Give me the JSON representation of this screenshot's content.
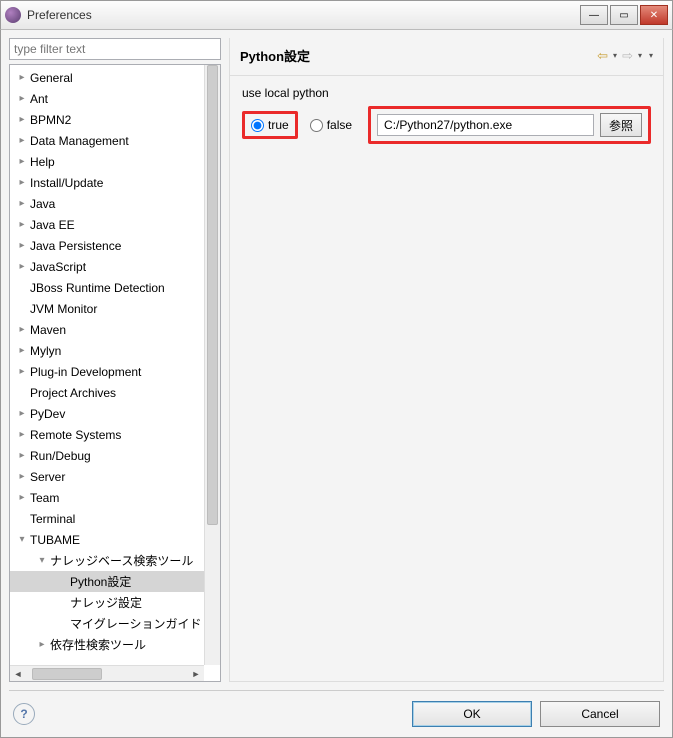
{
  "titlebar": {
    "title": "Preferences"
  },
  "filter": {
    "placeholder": "type filter text"
  },
  "tree": [
    {
      "label": "General",
      "depth": 1,
      "expandable": true,
      "expanded": false
    },
    {
      "label": "Ant",
      "depth": 1,
      "expandable": true,
      "expanded": false
    },
    {
      "label": "BPMN2",
      "depth": 1,
      "expandable": true,
      "expanded": false
    },
    {
      "label": "Data Management",
      "depth": 1,
      "expandable": true,
      "expanded": false
    },
    {
      "label": "Help",
      "depth": 1,
      "expandable": true,
      "expanded": false
    },
    {
      "label": "Install/Update",
      "depth": 1,
      "expandable": true,
      "expanded": false
    },
    {
      "label": "Java",
      "depth": 1,
      "expandable": true,
      "expanded": false
    },
    {
      "label": "Java EE",
      "depth": 1,
      "expandable": true,
      "expanded": false
    },
    {
      "label": "Java Persistence",
      "depth": 1,
      "expandable": true,
      "expanded": false
    },
    {
      "label": "JavaScript",
      "depth": 1,
      "expandable": true,
      "expanded": false
    },
    {
      "label": "JBoss Runtime Detection",
      "depth": 1,
      "expandable": false
    },
    {
      "label": "JVM Monitor",
      "depth": 1,
      "expandable": false
    },
    {
      "label": "Maven",
      "depth": 1,
      "expandable": true,
      "expanded": false
    },
    {
      "label": "Mylyn",
      "depth": 1,
      "expandable": true,
      "expanded": false
    },
    {
      "label": "Plug-in Development",
      "depth": 1,
      "expandable": true,
      "expanded": false
    },
    {
      "label": "Project Archives",
      "depth": 1,
      "expandable": false
    },
    {
      "label": "PyDev",
      "depth": 1,
      "expandable": true,
      "expanded": false
    },
    {
      "label": "Remote Systems",
      "depth": 1,
      "expandable": true,
      "expanded": false
    },
    {
      "label": "Run/Debug",
      "depth": 1,
      "expandable": true,
      "expanded": false
    },
    {
      "label": "Server",
      "depth": 1,
      "expandable": true,
      "expanded": false
    },
    {
      "label": "Team",
      "depth": 1,
      "expandable": true,
      "expanded": false
    },
    {
      "label": "Terminal",
      "depth": 1,
      "expandable": false
    },
    {
      "label": "TUBAME",
      "depth": 1,
      "expandable": true,
      "expanded": true
    },
    {
      "label": "ナレッジベース検索ツール",
      "depth": 2,
      "expandable": true,
      "expanded": true
    },
    {
      "label": "Python設定",
      "depth": 3,
      "expandable": false,
      "selected": true
    },
    {
      "label": "ナレッジ設定",
      "depth": 3,
      "expandable": false
    },
    {
      "label": "マイグレーションガイド",
      "depth": 3,
      "expandable": false
    },
    {
      "label": "依存性検索ツール",
      "depth": 2,
      "expandable": true,
      "expanded": false
    }
  ],
  "page": {
    "title": "Python設定",
    "group_label": "use local python",
    "radio_true": "true",
    "radio_false": "false",
    "path_value": "C:/Python27/python.exe",
    "browse": "参照"
  },
  "buttons": {
    "ok": "OK",
    "cancel": "Cancel"
  }
}
